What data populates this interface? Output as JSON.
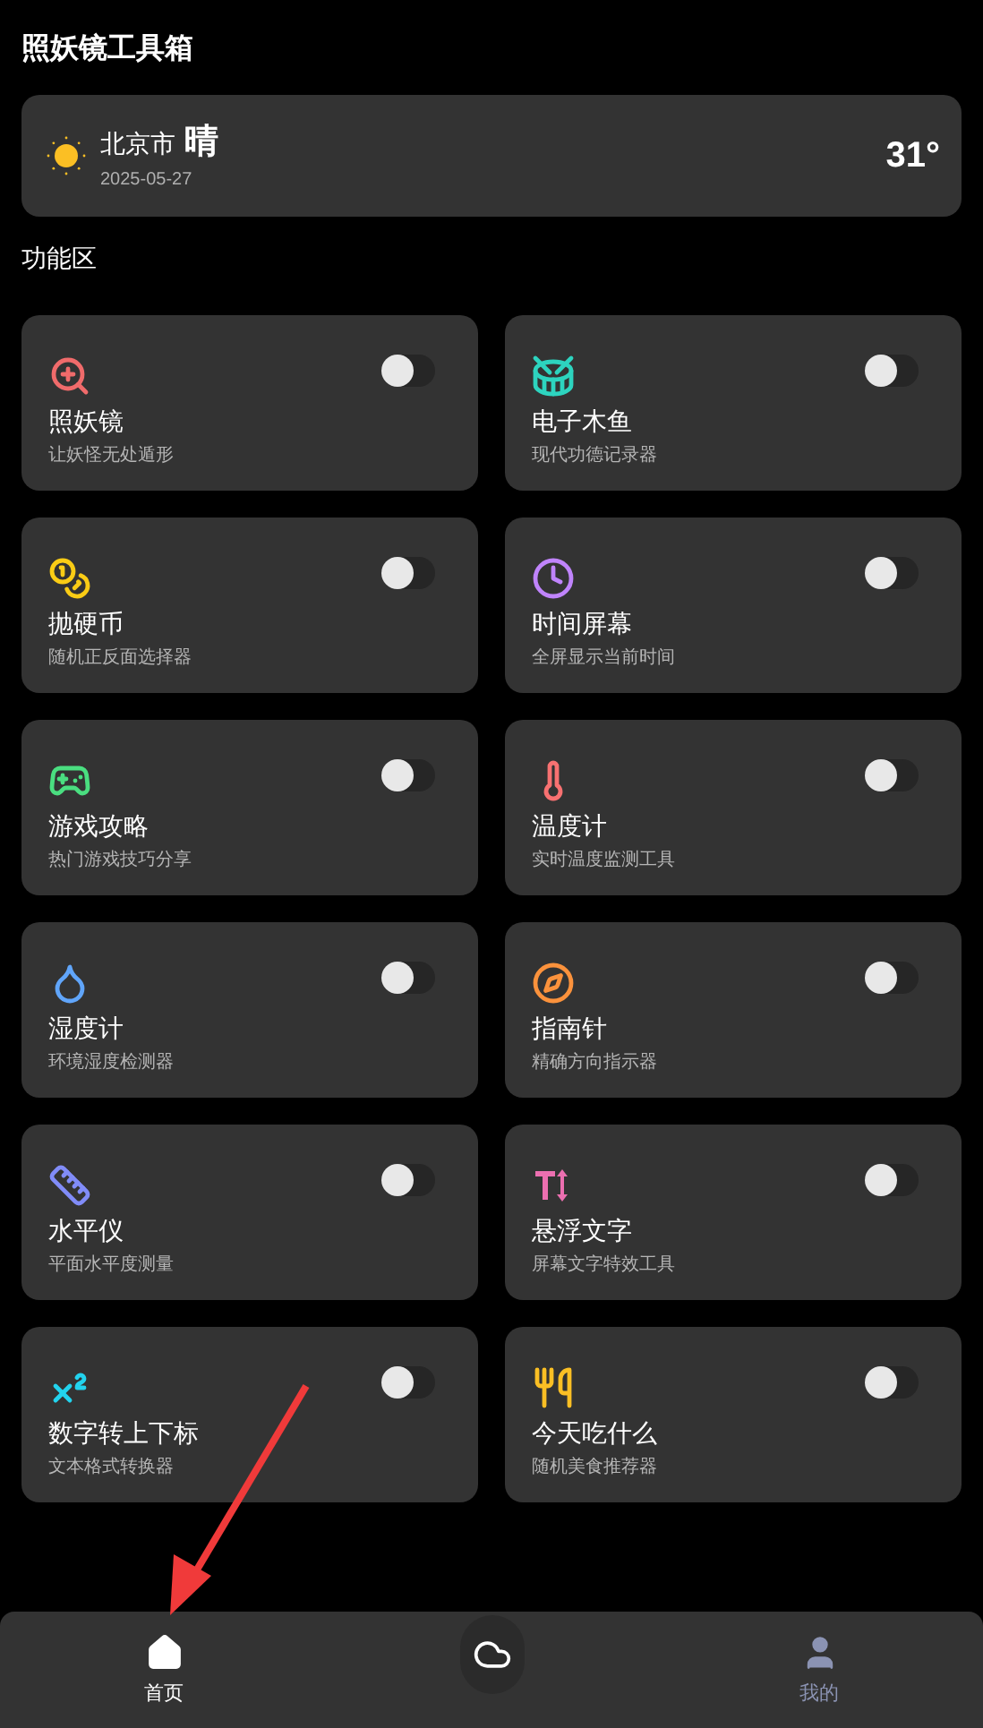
{
  "app_title": "照妖镜工具箱",
  "weather": {
    "city": "北京市",
    "condition": "晴",
    "date": "2025-05-27",
    "temperature": "31°"
  },
  "section_title": "功能区",
  "tools": [
    {
      "name": "照妖镜",
      "description": "让妖怪无处遁形",
      "on": false
    },
    {
      "name": "电子木鱼",
      "description": "现代功德记录器",
      "on": false
    },
    {
      "name": "抛硬币",
      "description": "随机正反面选择器",
      "on": false
    },
    {
      "name": "时间屏幕",
      "description": "全屏显示当前时间",
      "on": false
    },
    {
      "name": "游戏攻略",
      "description": "热门游戏技巧分享",
      "on": false
    },
    {
      "name": "温度计",
      "description": "实时温度监测工具",
      "on": false
    },
    {
      "name": "湿度计",
      "description": "环境湿度检测器",
      "on": false
    },
    {
      "name": "指南针",
      "description": "精确方向指示器",
      "on": false
    },
    {
      "name": "水平仪",
      "description": "平面水平度测量",
      "on": false
    },
    {
      "name": "悬浮文字",
      "description": "屏幕文字特效工具",
      "on": false
    },
    {
      "name": "数字转上下标",
      "description": "文本格式转换器",
      "on": false
    },
    {
      "name": "今天吃什么",
      "description": "随机美食推荐器",
      "on": false
    }
  ],
  "bottom_nav": [
    {
      "kind": "home",
      "label": "首页",
      "selected": true
    },
    {
      "kind": "weather",
      "selected": false
    },
    {
      "kind": "profile",
      "label": "我的",
      "selected": false
    }
  ]
}
